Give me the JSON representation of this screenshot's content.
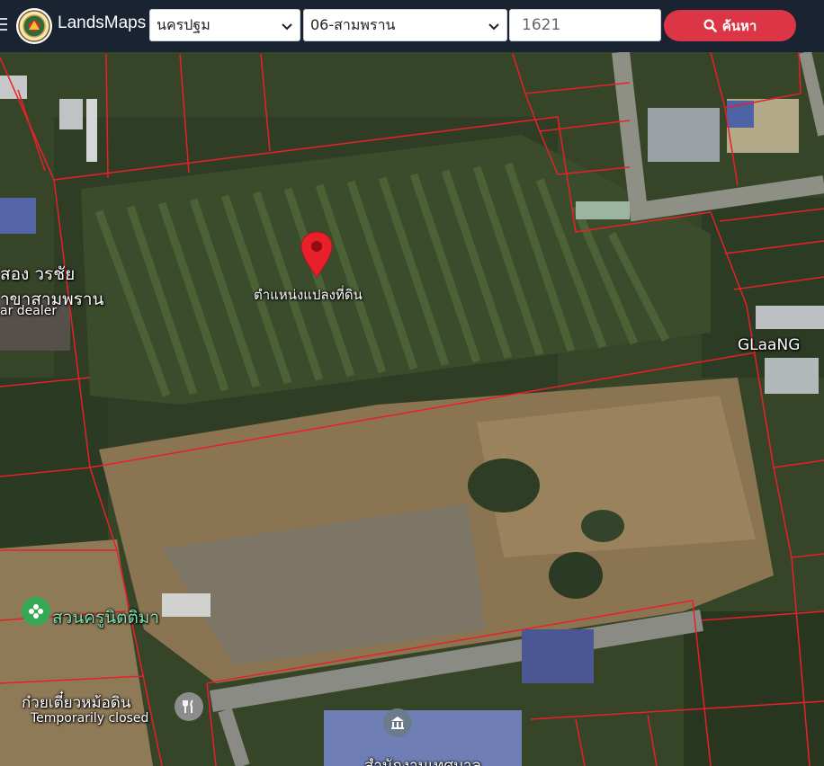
{
  "header": {
    "brand": "LandsMaps",
    "province_select": {
      "value": "นครปฐม"
    },
    "district_select": {
      "value": "06-สามพราน"
    },
    "parcel_input": {
      "value": "1621"
    },
    "search_button": {
      "label": "ค้นหา"
    }
  },
  "map": {
    "pin_caption": "ตำแหน่งแปลงที่ดิน",
    "labels": {
      "dealer_line1": "สอง วรชัย",
      "dealer_line2": "าขาสามพราน",
      "dealer_line3": "ar dealer",
      "glaang": "GLaaNG",
      "park": "สวนครูนิตติมา",
      "restaurant": "ก๋วยเตี๋ยวหม้อดิน",
      "closed": "Temporarily closed",
      "office": "สำนักงานเทศบาล"
    }
  },
  "colors": {
    "topbar": "#1a2332",
    "search_button": "#dc3545",
    "parcel_lines": "#e8202a",
    "pin": "#e8202a"
  }
}
